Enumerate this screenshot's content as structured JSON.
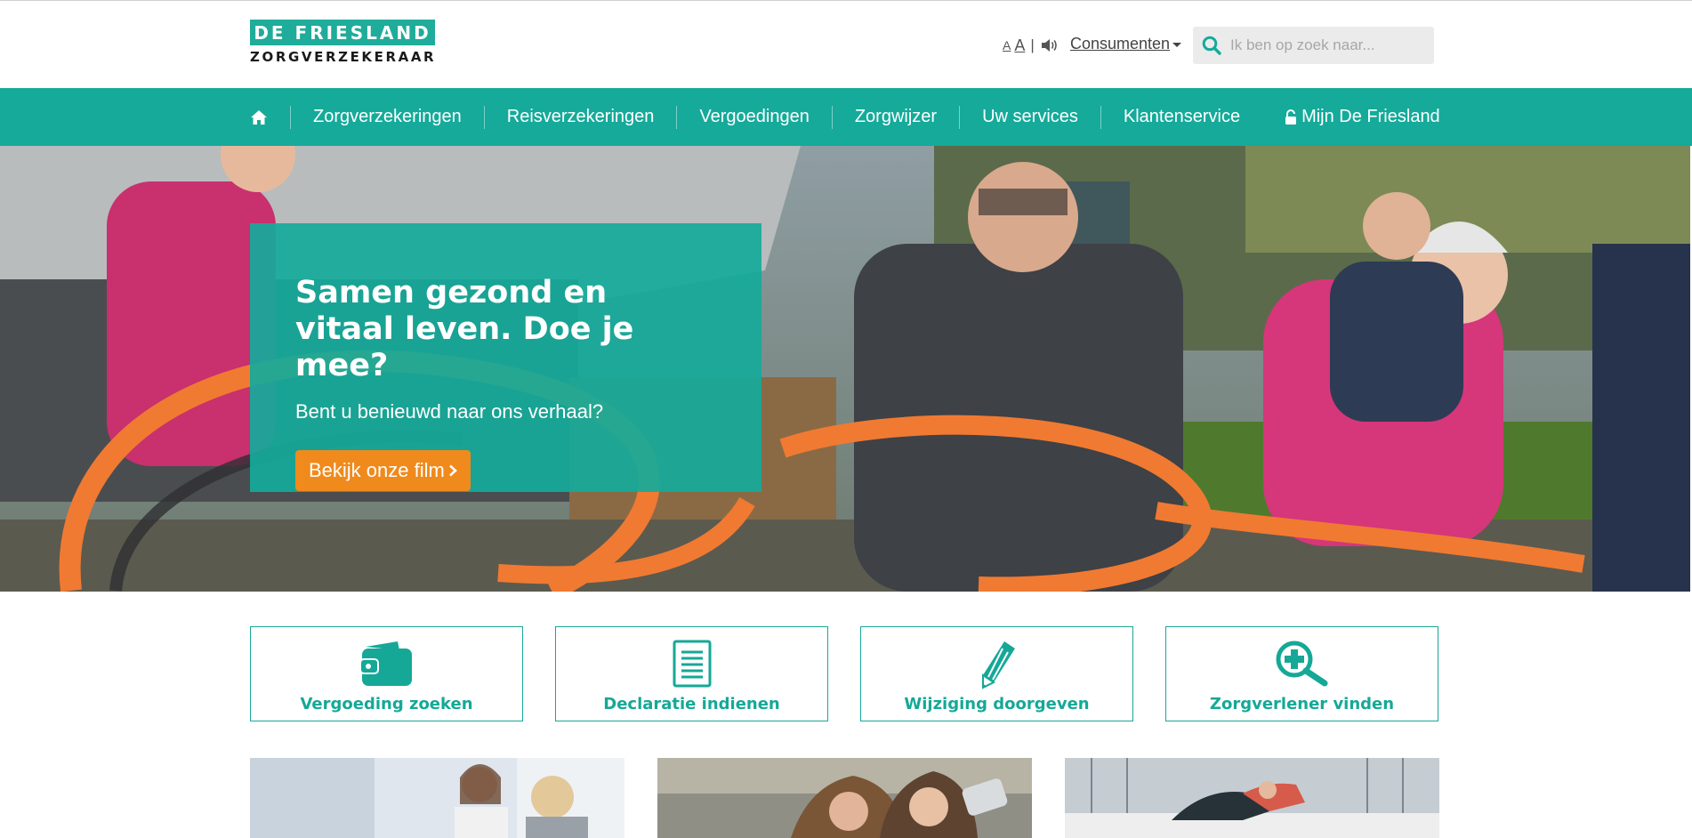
{
  "header": {
    "logo_line1": "DE FRIESLAND",
    "logo_line2": "ZORGVERZEKERAAR",
    "font_small": "A",
    "font_large": "A",
    "separator": "|",
    "audience_menu": "Consumenten",
    "search_placeholder": "Ik ben op zoek naar...",
    "search_icon": "search-icon",
    "speaker_icon": "speaker-icon"
  },
  "nav": {
    "home_icon": "home-icon",
    "items": [
      {
        "label": "Zorgverzekeringen"
      },
      {
        "label": "Reisverzekeringen"
      },
      {
        "label": "Vergoedingen"
      },
      {
        "label": "Zorgwijzer"
      },
      {
        "label": "Uw services"
      },
      {
        "label": "Klantenservice"
      },
      {
        "label": "Mijn De Friesland",
        "icon": "lock-icon"
      }
    ]
  },
  "hero": {
    "title": "Samen gezond en vitaal leven. Doe je mee?",
    "subtitle": "Bent u benieuwd naar ons verhaal?",
    "cta_label": "Bekijk onze film",
    "cta_icon": "chevron-right-icon"
  },
  "quick_links": [
    {
      "label": "Vergoeding zoeken",
      "icon": "wallet-icon"
    },
    {
      "label": "Declaratie indienen",
      "icon": "document-icon"
    },
    {
      "label": "Wijziging doorgeven",
      "icon": "pencil-icon"
    },
    {
      "label": "Zorgverlener vinden",
      "icon": "medical-search-icon"
    }
  ],
  "colors": {
    "brand_teal": "#15aa9a",
    "cta_orange": "#f08a1c"
  }
}
